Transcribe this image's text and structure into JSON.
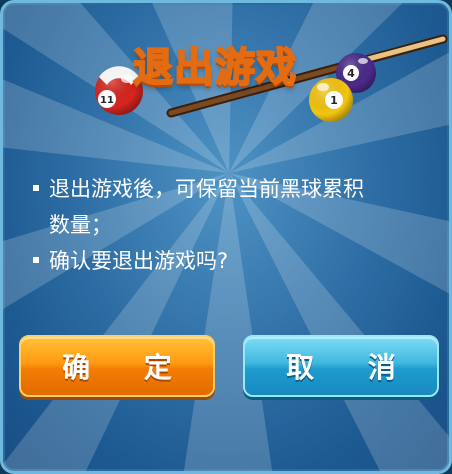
{
  "dialog": {
    "title": "退出游戏",
    "message_lines": [
      "退出游戏後，可保留当前黑球累积",
      "数量；",
      "确认要退出游戏吗?"
    ],
    "balls": {
      "ball_left_number": "11",
      "ball_right_top_number": "4",
      "ball_right_bottom_number": "1"
    },
    "buttons": {
      "confirm_label": "确 定",
      "cancel_label": "取 消"
    }
  },
  "colors": {
    "background": "#2f6fa6",
    "title_fill": "#ffe24a",
    "title_outline": "#e36b12",
    "confirm_button": "#ff9a12",
    "cancel_button": "#3fb8e0"
  }
}
